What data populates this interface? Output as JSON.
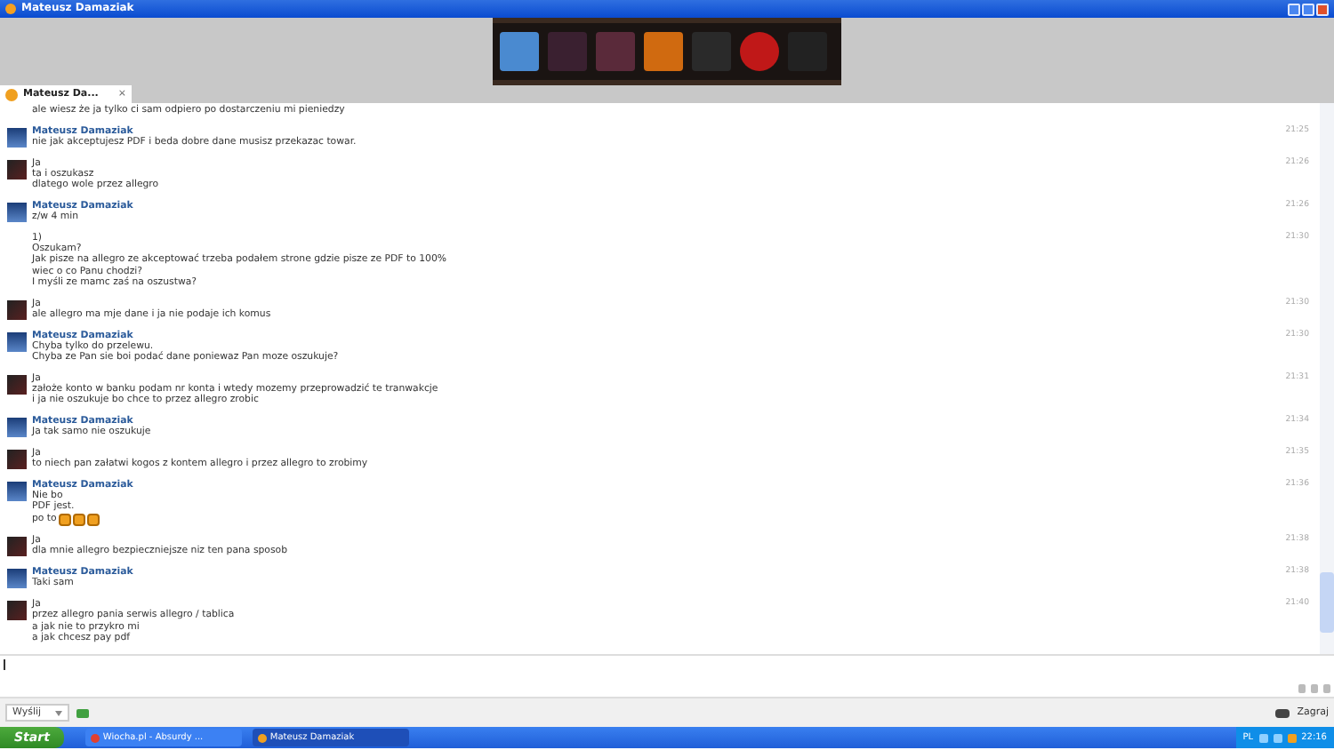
{
  "window": {
    "title": "Mateusz Damaziak"
  },
  "tabs": [
    {
      "label": "Mateusz Da...",
      "selected": true,
      "close": "×"
    }
  ],
  "messages": [
    {
      "kind": "continuation",
      "lines": [
        "ale wiesz że ja tylko ci sam odpiero po dostarczeniu mi pieniedzy"
      ]
    },
    {
      "kind": "contact",
      "sender": "Mateusz Damaziak",
      "time": "21:25",
      "lines": [
        "nie jak akceptujesz PDF i beda dobre dane musisz przekazac towar."
      ]
    },
    {
      "kind": "own",
      "sender": "Ja",
      "time": "21:26",
      "lines": [
        "ta i oszukasz",
        "dlatego wole przez allegro"
      ]
    },
    {
      "kind": "contact",
      "sender": "Mateusz Damaziak",
      "time": "21:26",
      "lines": [
        "z/w 4 min"
      ]
    },
    {
      "kind": "continuation",
      "time": "21:30",
      "lines": [
        "1)",
        "Oszukam?",
        "Jak pisze na allegro ze akceptować trzeba podałem strone gdzie pisze ze PDF to 100%",
        "wiec o co Panu chodzi?",
        "I myśli ze mamc zaś na oszustwa?"
      ]
    },
    {
      "kind": "own",
      "sender": "Ja",
      "time": "21:30",
      "lines": [
        "ale allegro ma mje dane i ja nie podaje ich komus"
      ]
    },
    {
      "kind": "contact",
      "sender": "Mateusz Damaziak",
      "time": "21:30",
      "lines": [
        "Chyba tylko do przelewu.",
        "Chyba ze Pan sie boi podać dane poniewaz Pan moze oszukuje?"
      ]
    },
    {
      "kind": "own",
      "sender": "Ja",
      "time": "21:31",
      "lines": [
        "założe konto w banku podam nr konta i wtedy mozemy przeprowadzić te tranwakcje",
        "i ja  nie oszukuje bo chce to przez allegro zrobic"
      ]
    },
    {
      "kind": "contact",
      "sender": "Mateusz Damaziak",
      "time": "21:34",
      "lines": [
        "Ja tak samo nie oszukuje"
      ]
    },
    {
      "kind": "own",
      "sender": "Ja",
      "time": "21:35",
      "lines": [
        "to niech pan załatwi kogos z kontem allegro i przez allegro to zrobimy"
      ]
    },
    {
      "kind": "contact",
      "sender": "Mateusz Damaziak",
      "time": "21:36",
      "lines": [
        "Nie bo",
        "PDF jest.",
        "po to"
      ],
      "emoticons": [
        {
          "kind": "face"
        },
        {
          "kind": "face"
        },
        {
          "kind": "face"
        }
      ]
    },
    {
      "kind": "own",
      "sender": "Ja",
      "time": "21:38",
      "lines": [
        "dla mnie allegro bezpieczniejsze niz ten pana sposob"
      ]
    },
    {
      "kind": "contact",
      "sender": "Mateusz Damaziak",
      "time": "21:38",
      "lines": [
        "Taki sam"
      ]
    },
    {
      "kind": "own",
      "sender": "Ja",
      "time": "21:40",
      "lines": [
        "przez allegro pania serwis allegro / tablica",
        "a jak nie to przykro mi",
        "a jak chcesz pay pdf"
      ]
    }
  ],
  "toolbar": {
    "send": "Wyślij",
    "game": "Zagraj"
  },
  "taskbar": {
    "start": "Start",
    "tasks": [
      {
        "label": "Wiocha.pl - Absurdy ...",
        "selected": false
      },
      {
        "label": "Mateusz Damaziak",
        "selected": true
      }
    ],
    "language": "PL",
    "clock": "22:16"
  }
}
